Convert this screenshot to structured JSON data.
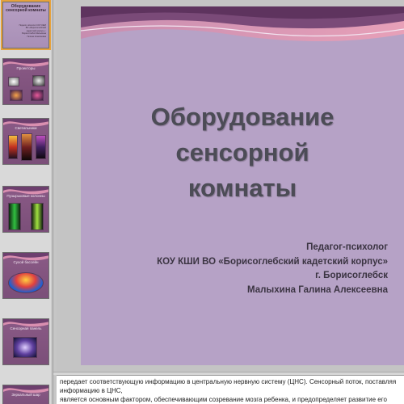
{
  "thumbnails": [
    {
      "title": "Оборудование сенсорной комнаты",
      "subtitle": "Педагог-психолог КОУ КШИ ВО «Борисоглебский кадетский корпус» г. Борисоглебск Малыхина Галина Алексеевна"
    },
    {
      "title": "Проекторы"
    },
    {
      "title": "Светильники"
    },
    {
      "title": "Пузырьковые колонны"
    },
    {
      "title": "Сухой бассейн"
    },
    {
      "title": "Сенсорная панель"
    },
    {
      "title": "Зеркальный шар"
    }
  ],
  "slide": {
    "title_line1": "Оборудование сенсорной",
    "title_line2": "комнаты",
    "author_line1": "Педагог-психолог",
    "author_line2": "КОУ КШИ ВО «Борисоглебский кадетский корпус»",
    "author_line3": "г. Борисоглебск",
    "author_line4": "Малыхина  Галина Алексеевна"
  },
  "notes": {
    "line1": "передает соответствующую информацию в центральную нервную систему (ЦНС). Сенсорный поток, поставляя информацию в ЦНС,",
    "line2": "является основным фактором, обеспечивающим созревание мозга ребенка, и предопределяет развитие его поведения и психики. Т"
  },
  "colors": {
    "slide_bg": "#b6a2c6",
    "thumb_bg": "#7b4f79",
    "title_text": "#4c4c56",
    "wave_pink": "#d98fb0",
    "wave_purple": "#6d3f6e"
  }
}
